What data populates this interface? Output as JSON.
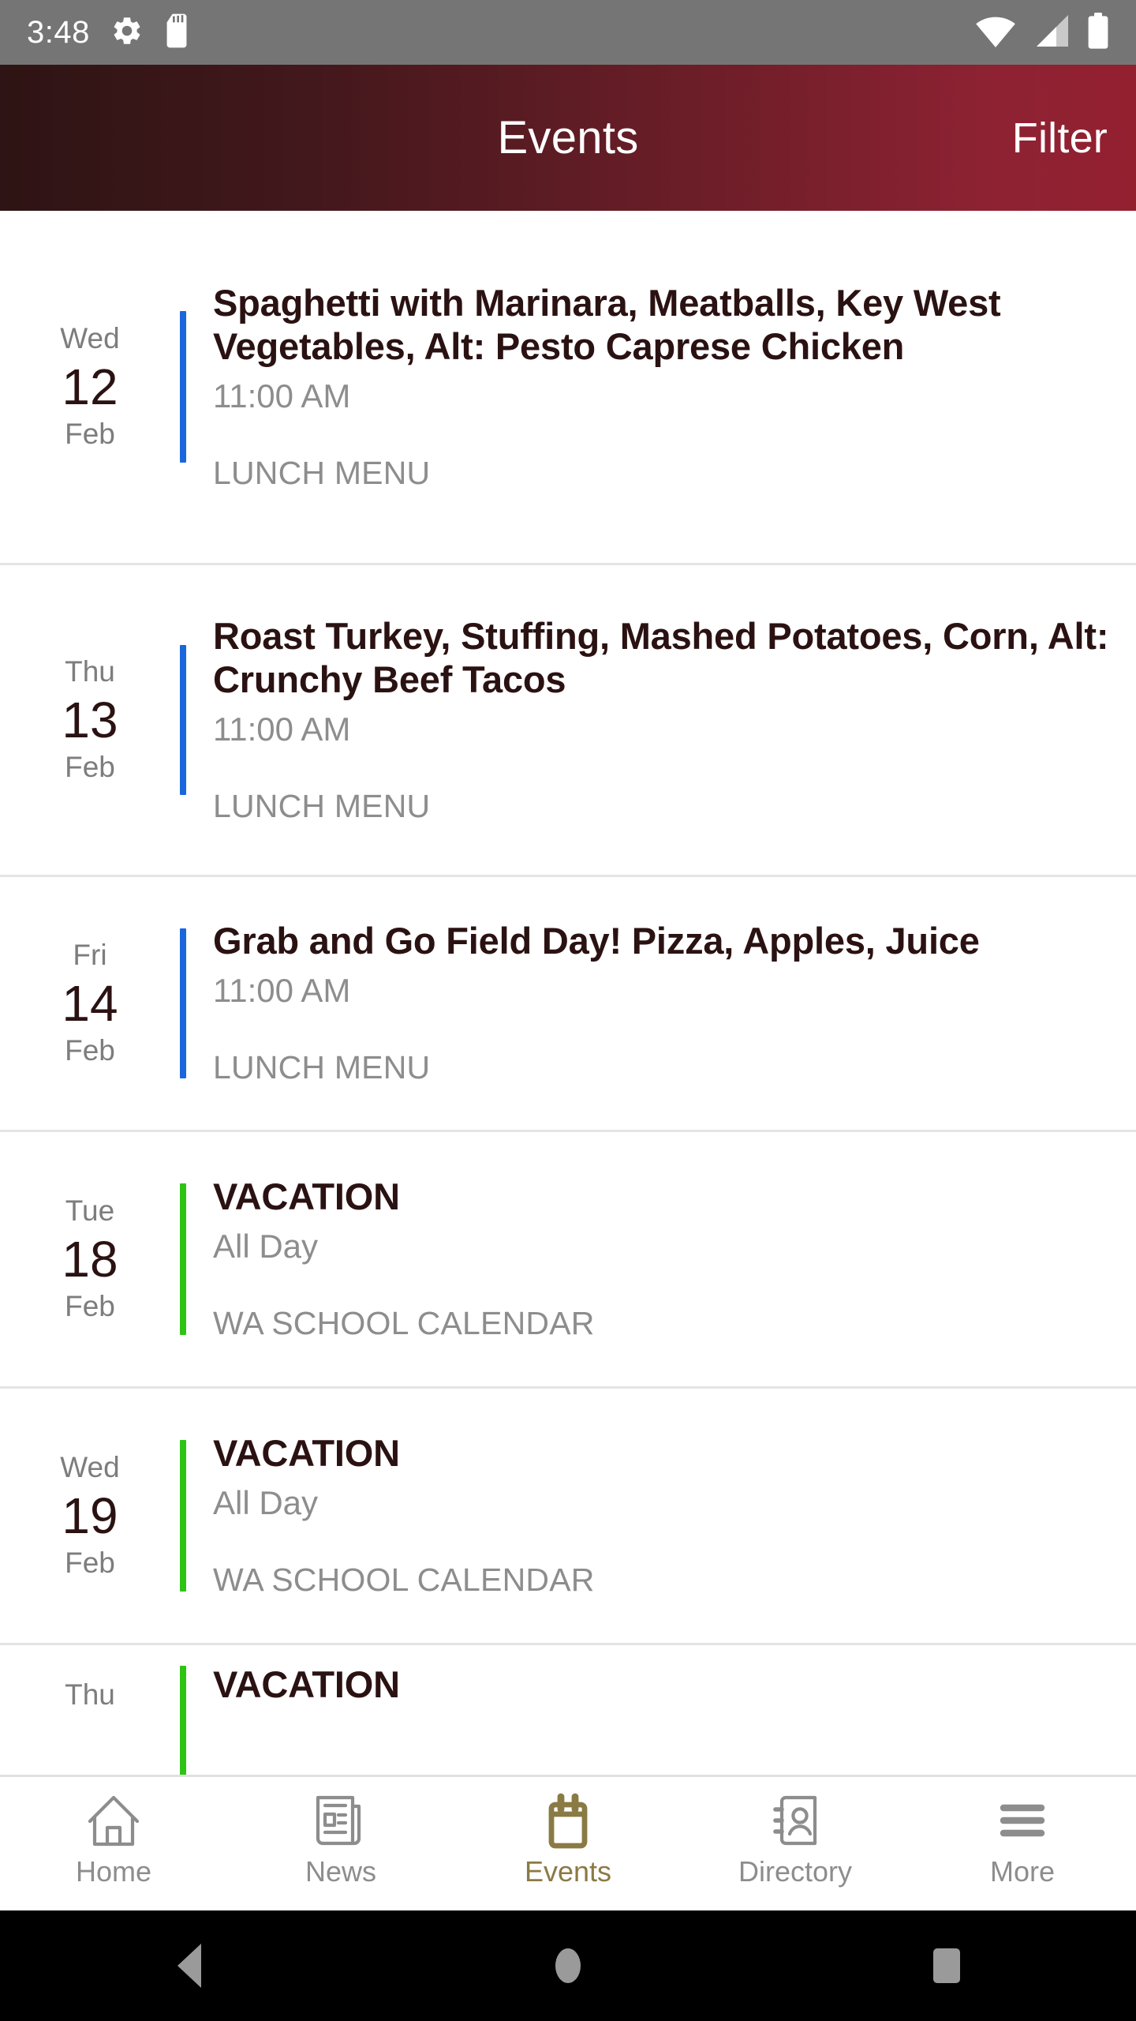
{
  "status_bar": {
    "clock": "3:48",
    "left_icons": [
      "gear-icon",
      "sd-card-icon"
    ],
    "right_icons": [
      "wifi-icon",
      "cellular-signal-icon",
      "battery-icon"
    ],
    "background": "#757575"
  },
  "app_bar": {
    "title": "Events",
    "action_label": "Filter",
    "gradient_from": "#2e1414",
    "gradient_to": "#93202f"
  },
  "events": [
    {
      "dow": "Wed",
      "day": "12",
      "month": "Feb",
      "title": "Spaghetti with Marinara, Meatballs, Key West Vegetables, Alt: Pesto Caprese Chicken",
      "time": "11:00 AM",
      "calendar": "LUNCH MENU",
      "accent_color": "#1a66dd"
    },
    {
      "dow": "Thu",
      "day": "13",
      "month": "Feb",
      "title": "Roast Turkey, Stuffing, Mashed Potatoes, Corn, Alt: Crunchy Beef Tacos",
      "time": "11:00 AM",
      "calendar": "LUNCH MENU",
      "accent_color": "#1a66dd"
    },
    {
      "dow": "Fri",
      "day": "14",
      "month": "Feb",
      "title": "Grab and Go Field Day!  Pizza, Apples, Juice",
      "time": "11:00 AM",
      "calendar": "LUNCH MENU",
      "accent_color": "#1a66dd"
    },
    {
      "dow": "Tue",
      "day": "18",
      "month": "Feb",
      "title": "VACATION",
      "time": "All Day",
      "calendar": "WA SCHOOL CALENDAR",
      "accent_color": "#2ec414"
    },
    {
      "dow": "Wed",
      "day": "19",
      "month": "Feb",
      "title": "VACATION",
      "time": "All Day",
      "calendar": "WA SCHOOL CALENDAR",
      "accent_color": "#2ec414"
    },
    {
      "dow": "Thu",
      "day": "",
      "month": "",
      "title": "VACATION",
      "time": "",
      "calendar": "",
      "accent_color": "#2ec414"
    }
  ],
  "tab_bar": {
    "active_color": "#8a7a44",
    "inactive_color": "#8d8d8d",
    "tabs": [
      {
        "label": "Home",
        "icon": "home-icon",
        "active": false
      },
      {
        "label": "News",
        "icon": "newspaper-icon",
        "active": false
      },
      {
        "label": "Events",
        "icon": "calendar-icon",
        "active": true
      },
      {
        "label": "Directory",
        "icon": "contact-book-icon",
        "active": false
      },
      {
        "label": "More",
        "icon": "hamburger-menu-icon",
        "active": false
      }
    ]
  },
  "system_nav": {
    "buttons": [
      "back-button",
      "home-button",
      "recents-button"
    ]
  }
}
